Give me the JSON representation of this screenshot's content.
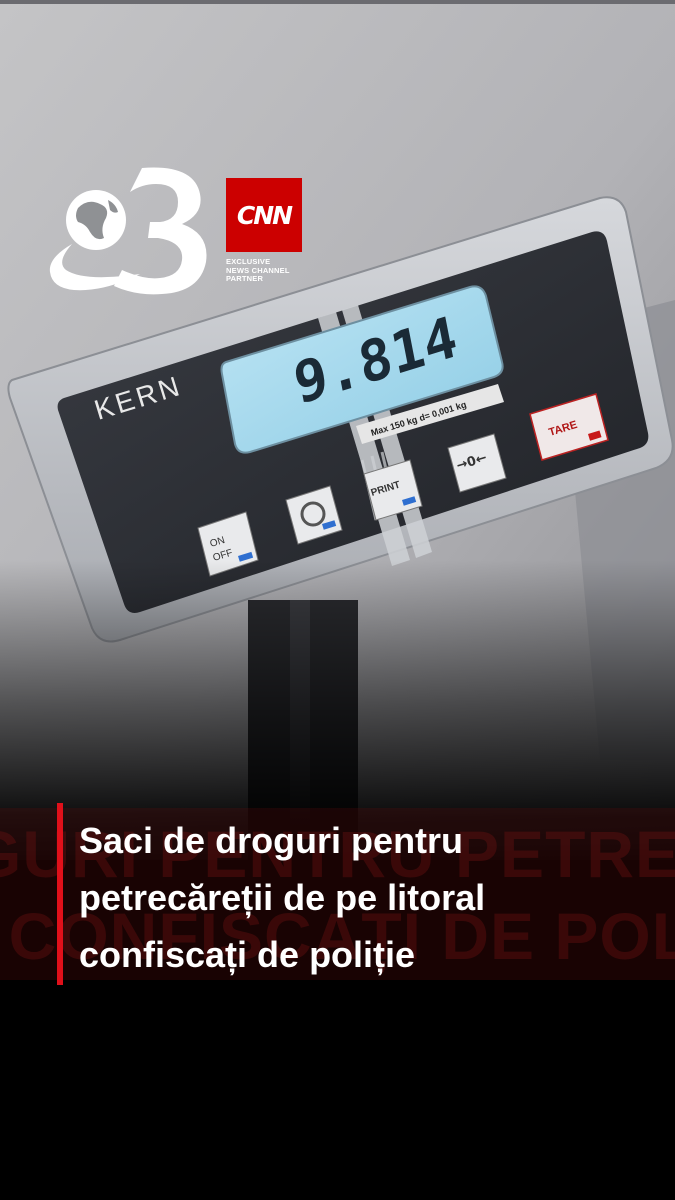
{
  "scale": {
    "brand": "KERN",
    "reading": "9.814",
    "spec_label": "Max 150 kg  d= 0,001 kg",
    "buttons": {
      "on_off": "ON\nOFF",
      "print": "PRINT",
      "zero": "→0←",
      "tare": "TARE"
    }
  },
  "branding": {
    "channel_logo_icon": "antena-3-globe-logo",
    "cnn_logo": "CNN",
    "cnn_subtitle": [
      "EXCLUSIVE",
      "NEWS CHANNEL",
      "PARTNER"
    ]
  },
  "headline": {
    "lines": [
      "Saci de droguri pentru",
      "petrecăreții de pe litoral",
      "confiscați de poliție"
    ],
    "ghost_lines": [
      "GURI PENTRU PETREC",
      "I CONFISCAȚI DE POL"
    ]
  },
  "colors": {
    "accent": "#e0101a",
    "cnn_red": "#cc0000",
    "lcd": "#9fd3ea"
  }
}
